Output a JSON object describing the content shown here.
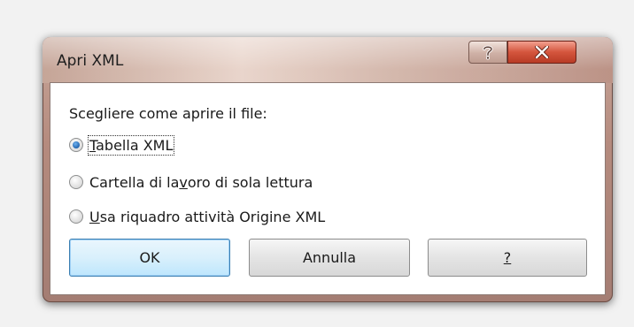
{
  "dialog": {
    "title": "Apri XML",
    "help_icon": "question-mark-icon",
    "close_icon": "close-x-icon",
    "accent_close": "#d4553d"
  },
  "content": {
    "prompt": "Scegliere come aprire il file:",
    "options": [
      {
        "prefix": "",
        "mnemonic": "T",
        "rest": "abella XML",
        "selected": true
      },
      {
        "prefix": "Cartella di la",
        "mnemonic": "v",
        "rest": "oro di sola lettura",
        "selected": false
      },
      {
        "prefix": "",
        "mnemonic": "U",
        "rest": "sa riquadro attività Origine XML",
        "selected": false
      }
    ]
  },
  "buttons": {
    "ok": "OK",
    "cancel": "Annulla",
    "help": "?"
  }
}
